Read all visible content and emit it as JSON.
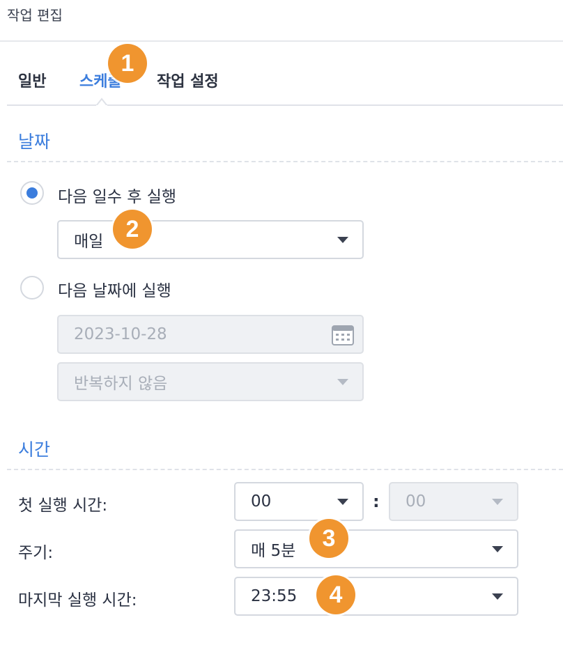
{
  "window": {
    "title": "작업 편집"
  },
  "tabs": [
    {
      "label": "일반",
      "active": false
    },
    {
      "label": "스케줄",
      "active": true
    },
    {
      "label": "작업 설정",
      "active": false
    }
  ],
  "date_section": {
    "title": "날짜",
    "option_days": {
      "label": "다음 일수 후 실행",
      "checked": true,
      "select_value": "매일"
    },
    "option_date": {
      "label": "다음 날짜에 실행",
      "checked": false,
      "date_value": "2023-10-28",
      "repeat_value": "반복하지 않음"
    }
  },
  "time_section": {
    "title": "시간",
    "first_run": {
      "label": "첫 실행 시간:",
      "hour": "00",
      "separator": ":",
      "minute": "00"
    },
    "frequency": {
      "label": "주기:",
      "value": "매 5분"
    },
    "last_run": {
      "label": "마지막 실행 시간:",
      "value": "23:55"
    }
  },
  "annotations": [
    "1",
    "2",
    "3",
    "4"
  ],
  "colors": {
    "accent": "#3b7ddd",
    "badge": "#f0952f",
    "text": "#2a3142"
  },
  "icons": {
    "calendar": "calendar-icon",
    "dropdown": "chevron-down-icon"
  }
}
